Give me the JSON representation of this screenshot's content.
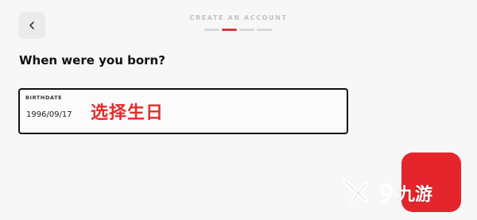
{
  "header": {
    "title": "CREATE AN ACCOUNT",
    "back_icon": "chevron-left-icon",
    "progress": {
      "total_steps": 4,
      "current_step": 2
    }
  },
  "form": {
    "question": "When were you born?",
    "birthdate_label": "BIRTHDATE",
    "birthdate_value": "1996/09/17"
  },
  "annotation": {
    "text": "选择生日"
  },
  "next_button": {
    "icon": "arrow-right-icon"
  },
  "watermark": {
    "text": "九游",
    "logo": "9game-logo"
  },
  "colors": {
    "accent": "#e5252c",
    "progress_active": "#d9363e",
    "progress_inactive": "#d8d8dc",
    "background": "#f7f7f8",
    "annotation": "#e52b2b"
  }
}
